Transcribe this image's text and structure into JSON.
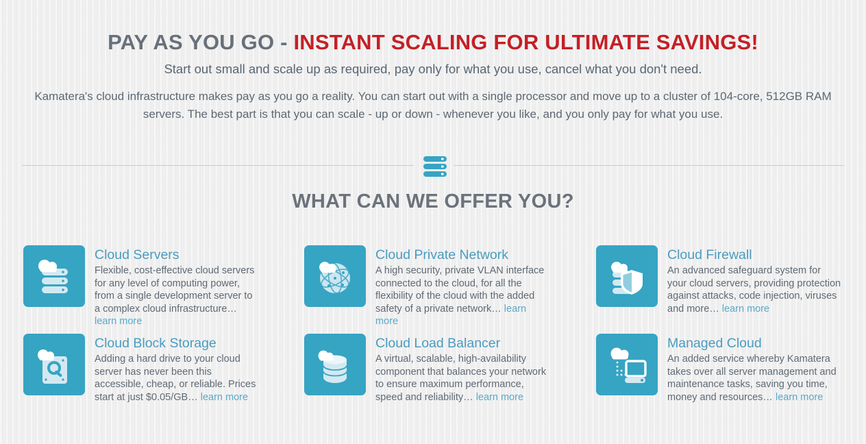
{
  "hero": {
    "title_part_grey": "PAY AS YOU GO - ",
    "title_part_red": "INSTANT SCALING FOR ULTIMATE SAVINGS!",
    "subtitle": "Start out small and scale up as required, pay only for what you use, cancel what you don't need.",
    "body": "Kamatera's cloud infrastructure makes pay as you go a reality. You can start out with a single processor and move up to a cluster of 104-core, 512GB RAM servers. The best part is that you can scale - up or down - whenever you like, and you only pay for what you use."
  },
  "divider": {
    "icon": "server-stack-icon"
  },
  "section": {
    "heading": "WHAT CAN WE OFFER YOU?"
  },
  "colors": {
    "teal": "#36a4c3",
    "title_blue": "#4a9cc0",
    "link_blue": "#5ba8c8",
    "heading_grey": "#6b727b",
    "red": "#c42026",
    "body_grey": "#5f6a74",
    "background": "#f2f2f2",
    "divider_grey": "#c9ccce"
  },
  "cards": [
    {
      "icon": "cloud-server-icon",
      "title": "Cloud Servers",
      "desc": "Flexible, cost-effective cloud servers for any level of computing power, from a single development server to a complex cloud infrastructure… ",
      "link": "learn more"
    },
    {
      "icon": "cloud-private-network-icon",
      "title": "Cloud Private Network",
      "desc": "A high security, private VLAN interface connected to the cloud, for all the flexibility of the cloud with the added safety of a private network… ",
      "link": "learn more"
    },
    {
      "icon": "cloud-firewall-icon",
      "title": "Cloud Firewall",
      "desc": "An advanced safeguard system for your cloud servers, providing protection against attacks, code injection, viruses and more… ",
      "link": "learn more"
    },
    {
      "icon": "cloud-block-storage-icon",
      "title": "Cloud Block Storage",
      "desc": "Adding a hard drive to your cloud server has never been this accessible, cheap, or reliable. Prices start at just $0.05/GB… ",
      "link": "learn more"
    },
    {
      "icon": "cloud-load-balancer-icon",
      "title": "Cloud Load Balancer",
      "desc": "A virtual, scalable, high-availability component that balances your network to ensure maximum performance, speed and reliability… ",
      "link": "learn more"
    },
    {
      "icon": "managed-cloud-icon",
      "title": "Managed Cloud",
      "desc": "An added service whereby Kamatera takes over all server management and maintenance tasks, saving you time, money and resources… ",
      "link": "learn more"
    }
  ]
}
